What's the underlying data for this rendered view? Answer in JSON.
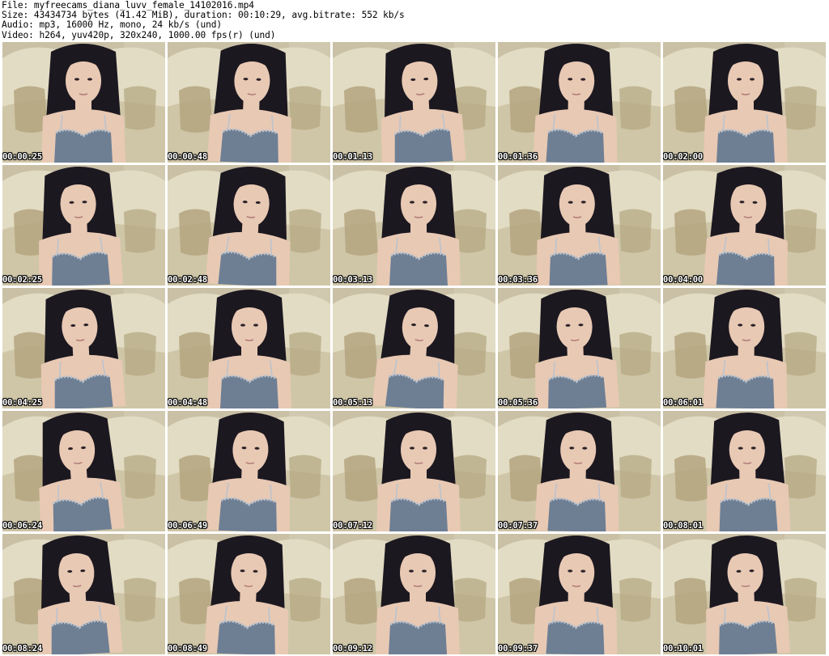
{
  "header": {
    "file": "File: myfreecams_diana_luvv_female_14102016.mp4",
    "size": "Size: 43434734 bytes (41.42 MiB), duration: 00:10:29, avg.bitrate: 552 kb/s",
    "audio": "Audio: mp3, 16000 Hz, mono, 24 kb/s (und)",
    "video": "Video: h264, yuv420p, 320x240, 1000.00 fps(r) (und)"
  },
  "thumbnails": [
    {
      "time": "00:00:25"
    },
    {
      "time": "00:00:48"
    },
    {
      "time": "00:01:13"
    },
    {
      "time": "00:01:36"
    },
    {
      "time": "00:02:00"
    },
    {
      "time": "00:02:25"
    },
    {
      "time": "00:02:48"
    },
    {
      "time": "00:03:13"
    },
    {
      "time": "00:03:36"
    },
    {
      "time": "00:04:00"
    },
    {
      "time": "00:04:25"
    },
    {
      "time": "00:04:48"
    },
    {
      "time": "00:05:13"
    },
    {
      "time": "00:05:36"
    },
    {
      "time": "00:06:01"
    },
    {
      "time": "00:06:24"
    },
    {
      "time": "00:06:49"
    },
    {
      "time": "00:07:12"
    },
    {
      "time": "00:07:37"
    },
    {
      "time": "00:08:01"
    },
    {
      "time": "00:08:24"
    },
    {
      "time": "00:08:49"
    },
    {
      "time": "00:09:12"
    },
    {
      "time": "00:09:37"
    },
    {
      "time": "00:10:01"
    }
  ],
  "colors": {
    "wall": "#c9c0a6",
    "couch": "#e2dcc4",
    "couch_shadow": "#cfc6a8",
    "pillow": "#b4a57f",
    "skin": "#e8c9b4",
    "hair": "#1c1820",
    "top": "#6e7f94",
    "lace": "#b9c3cf",
    "timestamp": "#ffffff"
  }
}
